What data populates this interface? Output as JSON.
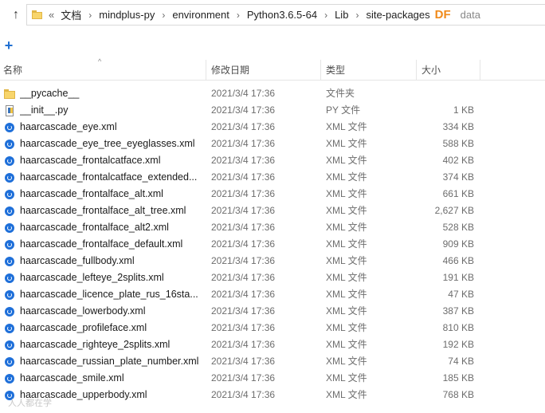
{
  "address_bar": {
    "lead": "«",
    "crumbs": [
      "文档",
      "mindplus-py",
      "environment",
      "Python3.6.5-64",
      "Lib",
      "site-packages",
      "data"
    ],
    "watermark": "DF"
  },
  "toolbar": {
    "new_label": "+"
  },
  "columns": {
    "name": "名称",
    "date": "修改日期",
    "type": "类型",
    "size": "大小"
  },
  "files": [
    {
      "name": "__pycache__",
      "date": "2021/3/4 17:36",
      "type": "文件夹",
      "size": "",
      "icon": "folder-icon"
    },
    {
      "name": "__init__.py",
      "date": "2021/3/4 17:36",
      "type": "PY 文件",
      "size": "1 KB",
      "icon": "python-file-icon"
    },
    {
      "name": "haarcascade_eye.xml",
      "date": "2021/3/4 17:36",
      "type": "XML 文件",
      "size": "334 KB",
      "icon": "xml-file-icon"
    },
    {
      "name": "haarcascade_eye_tree_eyeglasses.xml",
      "date": "2021/3/4 17:36",
      "type": "XML 文件",
      "size": "588 KB",
      "icon": "xml-file-icon"
    },
    {
      "name": "haarcascade_frontalcatface.xml",
      "date": "2021/3/4 17:36",
      "type": "XML 文件",
      "size": "402 KB",
      "icon": "xml-file-icon"
    },
    {
      "name": "haarcascade_frontalcatface_extended...",
      "date": "2021/3/4 17:36",
      "type": "XML 文件",
      "size": "374 KB",
      "icon": "xml-file-icon"
    },
    {
      "name": "haarcascade_frontalface_alt.xml",
      "date": "2021/3/4 17:36",
      "type": "XML 文件",
      "size": "661 KB",
      "icon": "xml-file-icon"
    },
    {
      "name": "haarcascade_frontalface_alt_tree.xml",
      "date": "2021/3/4 17:36",
      "type": "XML 文件",
      "size": "2,627 KB",
      "icon": "xml-file-icon"
    },
    {
      "name": "haarcascade_frontalface_alt2.xml",
      "date": "2021/3/4 17:36",
      "type": "XML 文件",
      "size": "528 KB",
      "icon": "xml-file-icon"
    },
    {
      "name": "haarcascade_frontalface_default.xml",
      "date": "2021/3/4 17:36",
      "type": "XML 文件",
      "size": "909 KB",
      "icon": "xml-file-icon"
    },
    {
      "name": "haarcascade_fullbody.xml",
      "date": "2021/3/4 17:36",
      "type": "XML 文件",
      "size": "466 KB",
      "icon": "xml-file-icon"
    },
    {
      "name": "haarcascade_lefteye_2splits.xml",
      "date": "2021/3/4 17:36",
      "type": "XML 文件",
      "size": "191 KB",
      "icon": "xml-file-icon"
    },
    {
      "name": "haarcascade_licence_plate_rus_16sta...",
      "date": "2021/3/4 17:36",
      "type": "XML 文件",
      "size": "47 KB",
      "icon": "xml-file-icon"
    },
    {
      "name": "haarcascade_lowerbody.xml",
      "date": "2021/3/4 17:36",
      "type": "XML 文件",
      "size": "387 KB",
      "icon": "xml-file-icon"
    },
    {
      "name": "haarcascade_profileface.xml",
      "date": "2021/3/4 17:36",
      "type": "XML 文件",
      "size": "810 KB",
      "icon": "xml-file-icon"
    },
    {
      "name": "haarcascade_righteye_2splits.xml",
      "date": "2021/3/4 17:36",
      "type": "XML 文件",
      "size": "192 KB",
      "icon": "xml-file-icon"
    },
    {
      "name": "haarcascade_russian_plate_number.xml",
      "date": "2021/3/4 17:36",
      "type": "XML 文件",
      "size": "74 KB",
      "icon": "xml-file-icon"
    },
    {
      "name": "haarcascade_smile.xml",
      "date": "2021/3/4 17:36",
      "type": "XML 文件",
      "size": "185 KB",
      "icon": "xml-file-icon"
    },
    {
      "name": "haarcascade_upperbody.xml",
      "date": "2021/3/4 17:36",
      "type": "XML 文件",
      "size": "768 KB",
      "icon": "xml-file-icon"
    }
  ],
  "bottom_watermark": "人人都在学",
  "colors": {
    "accent": "#1f6fd1",
    "folder": "#f8d56b",
    "watermark": "#f08a1a"
  }
}
